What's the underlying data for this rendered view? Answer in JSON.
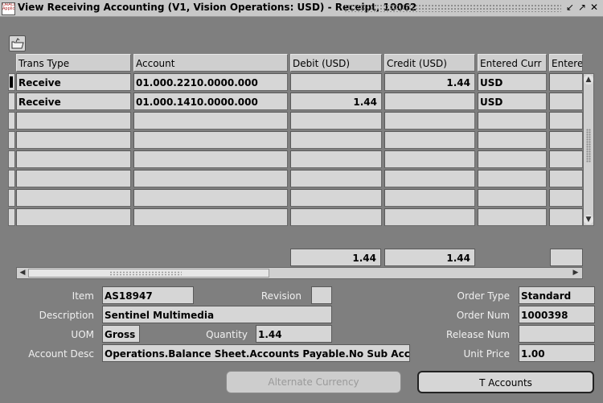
{
  "window": {
    "title": "View Receiving Accounting (V1, Vision Operations: USD) - Receipt, 10062",
    "icon_text": "ORACLE Applications",
    "controls": [
      "↙",
      "↗",
      "✕"
    ]
  },
  "toolbar": {
    "folder_icon": "folder-icon"
  },
  "table": {
    "columns": [
      "Trans Type",
      "Account",
      "Debit (USD)",
      "Credit (USD)",
      "Entered Curr",
      "Entered"
    ],
    "rows": [
      {
        "trans_type": "Receive",
        "account": "01.000.2210.0000.000",
        "debit": "",
        "credit": "1.44",
        "entered_curr": "USD",
        "entered": ""
      },
      {
        "trans_type": "Receive",
        "account": "01.000.1410.0000.000",
        "debit": "1.44",
        "credit": "",
        "entered_curr": "USD",
        "entered": ""
      },
      {
        "trans_type": "",
        "account": "",
        "debit": "",
        "credit": "",
        "entered_curr": "",
        "entered": ""
      },
      {
        "trans_type": "",
        "account": "",
        "debit": "",
        "credit": "",
        "entered_curr": "",
        "entered": ""
      },
      {
        "trans_type": "",
        "account": "",
        "debit": "",
        "credit": "",
        "entered_curr": "",
        "entered": ""
      },
      {
        "trans_type": "",
        "account": "",
        "debit": "",
        "credit": "",
        "entered_curr": "",
        "entered": ""
      },
      {
        "trans_type": "",
        "account": "",
        "debit": "",
        "credit": "",
        "entered_curr": "",
        "entered": ""
      },
      {
        "trans_type": "",
        "account": "",
        "debit": "",
        "credit": "",
        "entered_curr": "",
        "entered": ""
      }
    ],
    "totals": {
      "debit": "1.44",
      "credit": "1.44",
      "entered": ""
    }
  },
  "details": {
    "item_label": "Item",
    "item": "AS18947",
    "revision_label": "Revision",
    "revision": "",
    "description_label": "Description",
    "description": "Sentinel Multimedia",
    "uom_label": "UOM",
    "uom": "Gross",
    "quantity_label": "Quantity",
    "quantity": "1.44",
    "account_desc_label": "Account Desc",
    "account_desc": "Operations.Balance Sheet.Accounts Payable.No Sub Accou",
    "order_type_label": "Order Type",
    "order_type": "Standard",
    "order_num_label": "Order Num",
    "order_num": "1000398",
    "release_num_label": "Release Num",
    "release_num": "",
    "unit_price_label": "Unit Price",
    "unit_price": "1.00"
  },
  "buttons": {
    "alternate_currency": "Alternate Currency",
    "t_accounts": "T Accounts"
  },
  "colors": {
    "background": "#7f7f7f",
    "field": "#d6d6d6",
    "titlebar": "#c8c8c8"
  }
}
